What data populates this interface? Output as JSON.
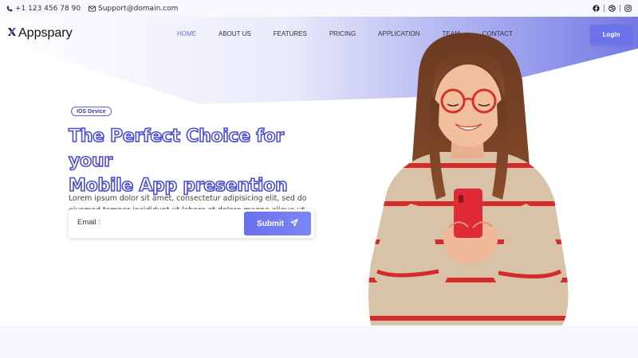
{
  "topbar": {
    "phone": "+1 123 456 78 90",
    "email": "Support@domain.com",
    "socials": [
      {
        "icon": "facebook-icon"
      },
      {
        "icon": "dribbble-icon"
      },
      {
        "icon": "instagram-icon"
      }
    ],
    "separator": "|"
  },
  "brand": {
    "name": "Appspary",
    "accent": "#6b72ea",
    "text_stroke": "#4b4fd0"
  },
  "nav": {
    "items": [
      {
        "label": "HOME",
        "active": true
      },
      {
        "label": "ABOUT US"
      },
      {
        "label": "FEATURES"
      },
      {
        "label": "PRICING"
      },
      {
        "label": "APPLICATION"
      },
      {
        "label": "TEAM"
      },
      {
        "label": "CONTACT"
      }
    ],
    "login_label": "Login"
  },
  "hero": {
    "badge": "IOS Device",
    "headline_line1": "The Perfect Choice for your",
    "headline_line2": "Mobile App presention",
    "description": "Lorem ipsum dolor sit amet, consectetur adipisicing elit, sed do eiusmod tempor incididunt ut labore et dolore magna aliqua ut labore et dolore.",
    "email_label": "Email :",
    "email_placeholder": "",
    "submit_label": "Submit",
    "submit_icon": "send-icon",
    "image": "woman-with-phone-image"
  }
}
